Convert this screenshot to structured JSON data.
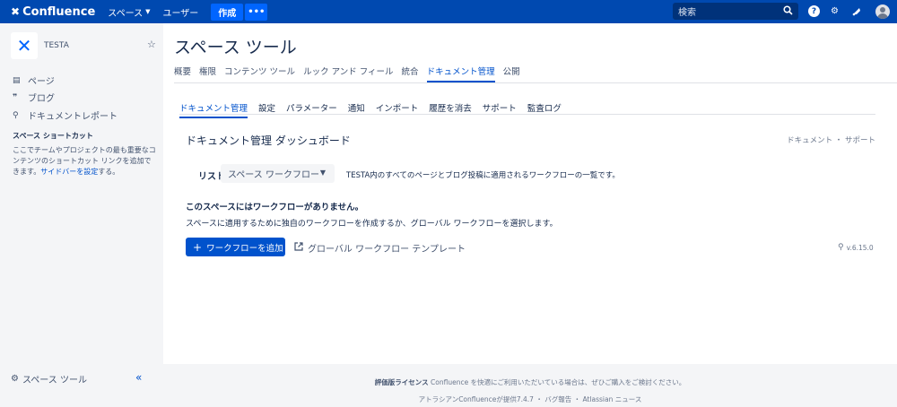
{
  "header": {
    "app_name": "Confluence",
    "nav_spaces": "スペース",
    "nav_users": "ユーザー",
    "create_label": "作成",
    "more_label": "•••",
    "search_placeholder": "検索",
    "help_label": "?"
  },
  "sidebar": {
    "space_name": "TESTA",
    "items": [
      {
        "icon": "page-icon",
        "label": "ページ"
      },
      {
        "icon": "quote-icon",
        "label": "ブログ"
      },
      {
        "icon": "document-report-icon",
        "label": "ドキュメントレポート"
      }
    ],
    "shortcuts_heading": "スペース ショートカット",
    "shortcuts_desc": "ここでチームやプロジェクトの最も重要なコンテンツのショートカット リンクを追加できます。",
    "shortcuts_link": "サイドバーを設定",
    "shortcuts_tail": "する。",
    "footer_label": "スペース ツール"
  },
  "main": {
    "title": "スペース ツール",
    "tabs": [
      {
        "label": "概要",
        "active": false
      },
      {
        "label": "権限",
        "active": false
      },
      {
        "label": "コンテンツ ツール",
        "active": false
      },
      {
        "label": "ルック アンド フィール",
        "active": false
      },
      {
        "label": "統合",
        "active": false
      },
      {
        "label": "ドキュメント管理",
        "active": true
      },
      {
        "label": "公開",
        "active": false
      }
    ],
    "subtabs": [
      {
        "label": "ドキュメント管理",
        "active": true
      },
      {
        "label": "設定",
        "active": false
      },
      {
        "label": "パラメーター",
        "active": false
      },
      {
        "label": "通知",
        "active": false
      },
      {
        "label": "インポート",
        "active": false
      },
      {
        "label": "履歴を消去",
        "active": false
      },
      {
        "label": "サポート",
        "active": false
      },
      {
        "label": "監査ログ",
        "active": false
      }
    ],
    "dashboard_title": "ドキュメント管理 ダッシュボード",
    "dashboard_links": "ドキュメント ・ サポート",
    "list_label": "リスト",
    "list_select_value": "スペース ワークフロー",
    "list_desc": "TESTA内のすべてのページとブログ投稿に適用されるワークフローの一覧です。",
    "empty_title": "このスペースにはワークフローがありません。",
    "empty_desc": "スペースに適用するために独自のワークフローを作成するか、グローバル ワークフローを選択します。",
    "add_button": "ワークフローを追加",
    "global_link": "グローバル ワークフロー テンプレート",
    "version": "v.6.15.0"
  },
  "footer": {
    "line1_bold": "評価版ライセンス",
    "line1_rest": " Confluence を快適にご利用いただいている場合は、ぜひご購入をご検討ください。",
    "line2": "アトラシアンConfluenceが提供7.4.7 ・ バグ報告 ・ Atlassian ニュース"
  },
  "colors": {
    "topbar": "#0049b0",
    "accent": "#0052cc",
    "create": "#0065ff"
  }
}
